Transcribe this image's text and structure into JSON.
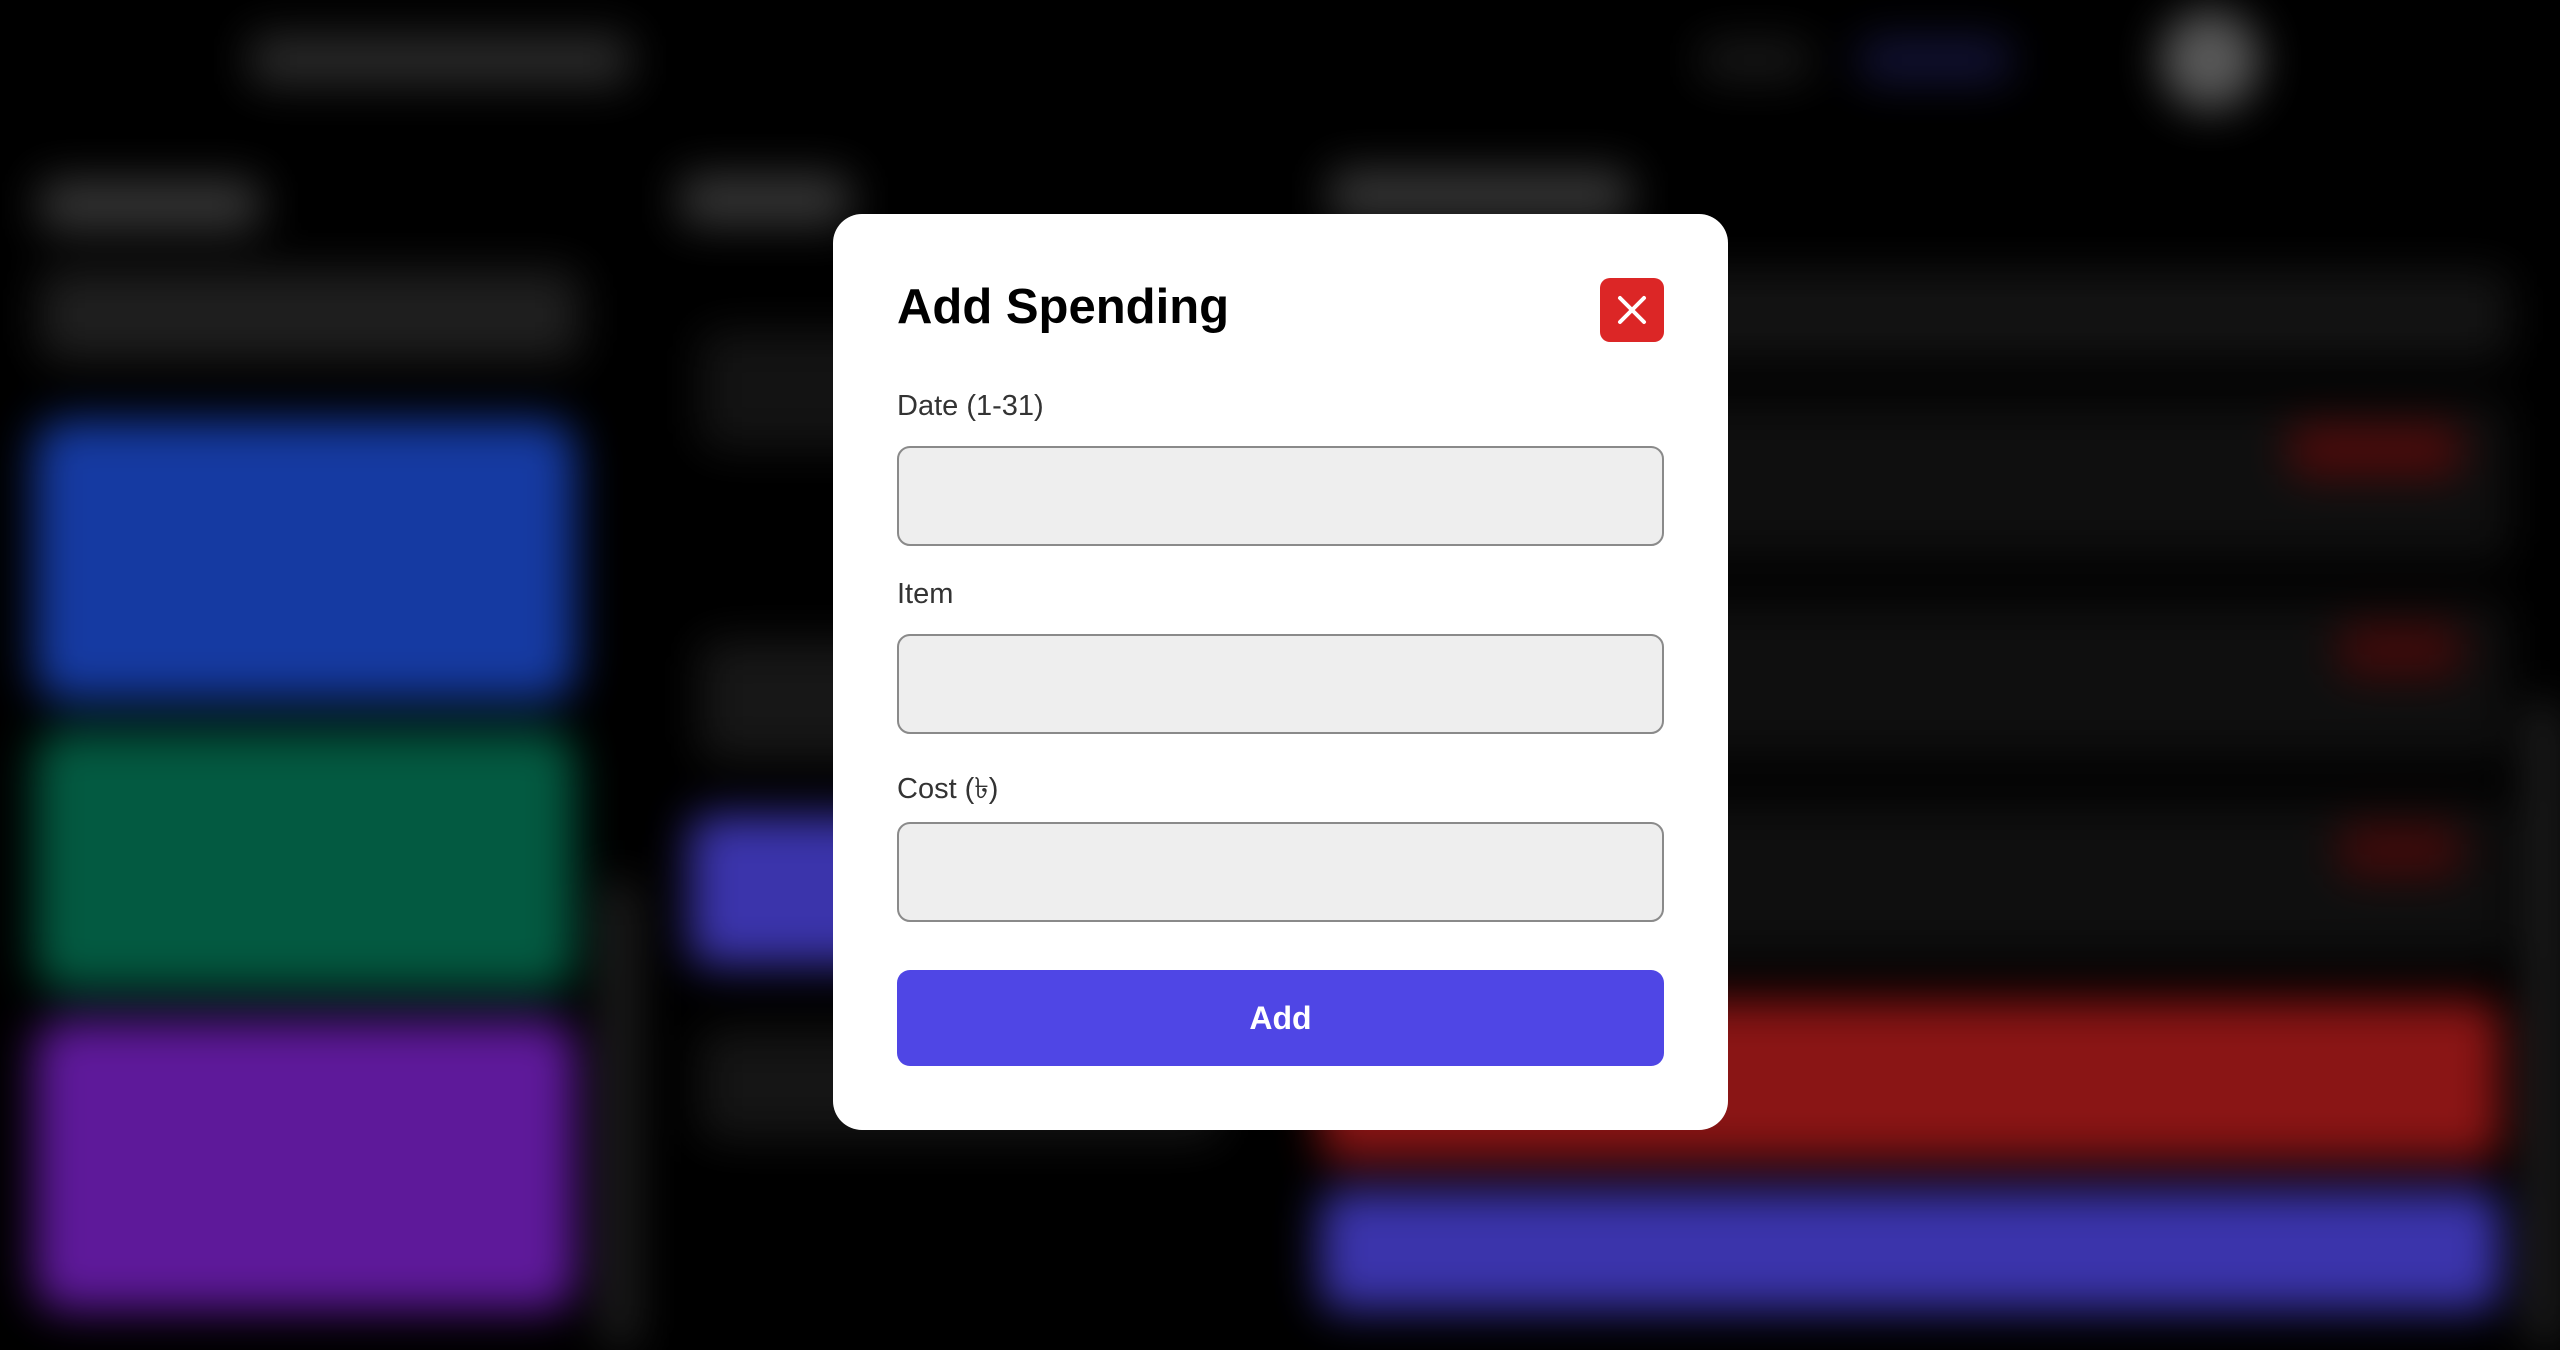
{
  "modal": {
    "title": "Add Spending",
    "fields": [
      {
        "label": "Date (1-31)",
        "value": "",
        "placeholder": ""
      },
      {
        "label": "Item",
        "value": "",
        "placeholder": ""
      },
      {
        "label": "Cost (৳)",
        "value": "",
        "placeholder": ""
      }
    ],
    "submit_label": "Add",
    "close_icon": "close-icon"
  },
  "colors": {
    "close_button": "#dc2626",
    "primary_button": "#4f46e5",
    "input_background": "#eeeeee"
  }
}
